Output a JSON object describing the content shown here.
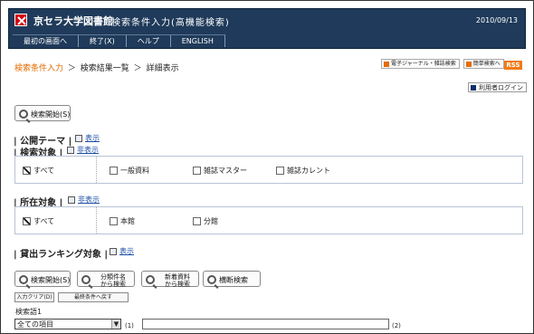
{
  "header": {
    "site_title": "京セラ大学図書館",
    "page_title": "検索条件入力(高機能検索)",
    "date": "2010/09/13"
  },
  "nav": [
    "最初の画面へ",
    "終了(X)",
    "ヘルプ",
    "ENGLISH"
  ],
  "breadcrumb": {
    "current": "検索条件入力",
    "sep1": "＞",
    "results": "検索結果一覧",
    "sep2": "＞",
    "detail": "詳細表示"
  },
  "top_links": {
    "journal": "電子ジャーナル・雑誌検索",
    "simple": "簡単検索へ",
    "rss": "RSS"
  },
  "login": "利用者ログイン",
  "search_button": "検索開始(S)",
  "sections": {
    "public_theme": "公開テーマ",
    "search_target": "検索対象",
    "location": "所在対象",
    "ranking": "貸出ランキング対象",
    "show": "表示",
    "hide": "非表示"
  },
  "targets": {
    "all": "すべて",
    "general": "一般資料",
    "magazine_master": "雑誌マスター",
    "magazine_current": "雑誌カレント"
  },
  "locations": {
    "all": "すべて",
    "main": "本館",
    "branch": "分館"
  },
  "buttons": {
    "search": "検索開始(S)",
    "classify": "分類件名\nから検索",
    "new": "新着資料\nから検索",
    "cross": "横断検索",
    "clear": "入力クリア(D)",
    "recent": "最終条件へ戻す"
  },
  "form": {
    "keyword_label": "検索語1",
    "field_select": "全ての項目",
    "suffix1": "(1)",
    "suffix2": "(2)"
  }
}
